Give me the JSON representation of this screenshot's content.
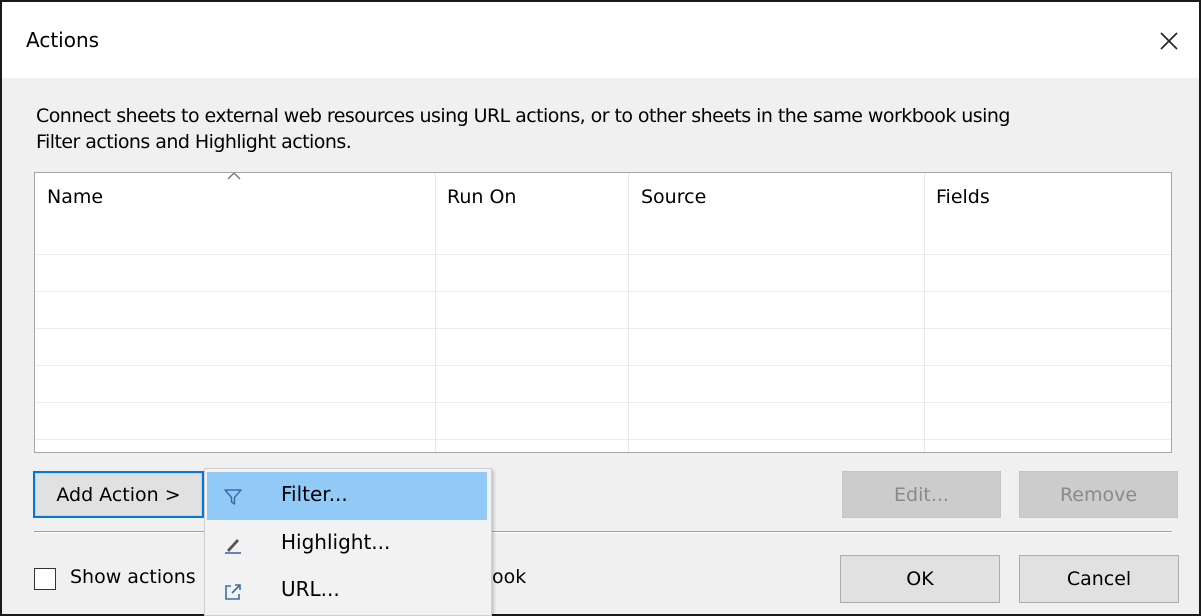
{
  "dialog": {
    "title": "Actions",
    "description_line1": "Connect sheets to external web resources using URL actions, or to other sheets in the same workbook using",
    "description_line2": "Filter actions and Highlight actions."
  },
  "table": {
    "columns": [
      "Name",
      "Run On",
      "Source",
      "Fields"
    ],
    "sorted_column": "Name",
    "rows": []
  },
  "buttons": {
    "add_action": "Add Action >",
    "edit": "Edit...",
    "remove": "Remove",
    "ok": "OK",
    "cancel": "Cancel"
  },
  "checkbox": {
    "label_visible_start": "Show actions",
    "label_visible_end": "ook",
    "checked": false
  },
  "add_action_menu": {
    "items": [
      {
        "label": "Filter...",
        "icon": "filter-icon",
        "highlighted": true
      },
      {
        "label": "Highlight...",
        "icon": "highlighter-icon",
        "highlighted": false
      },
      {
        "label": "URL...",
        "icon": "external-link-icon",
        "highlighted": false
      }
    ]
  },
  "colors": {
    "focus_border": "#0078d7",
    "menu_highlight": "#91c9f7",
    "disabled_text": "#8a8a8a",
    "icon_blue": "#3a6ea8"
  }
}
